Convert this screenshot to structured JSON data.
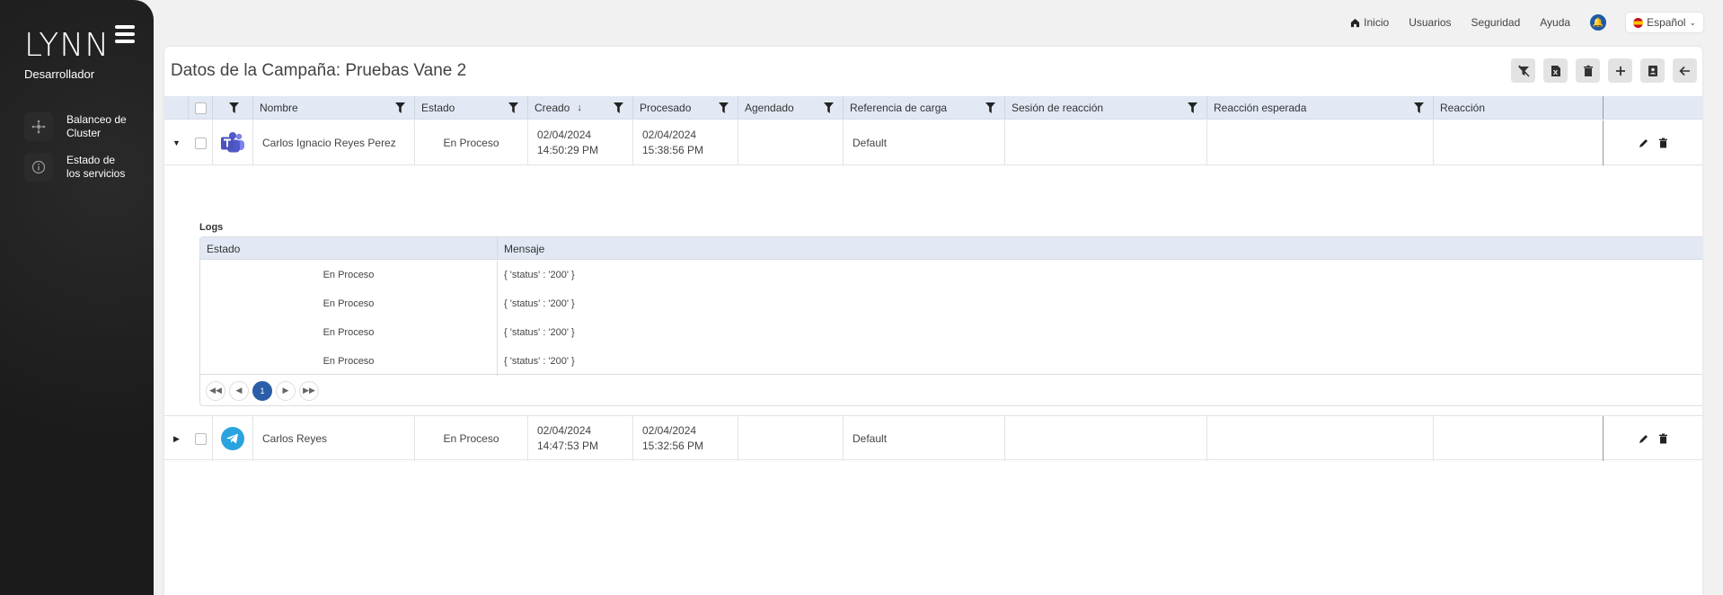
{
  "sidebar": {
    "logo": "LYNN",
    "role": "Desarrollador",
    "items": [
      {
        "label": "Balanceo de Cluster",
        "icon": "cluster-icon"
      },
      {
        "label": "Estado de los servicios",
        "icon": "info-icon"
      }
    ]
  },
  "topnav": {
    "home": "Inicio",
    "users": "Usuarios",
    "security": "Seguridad",
    "help": "Ayuda",
    "language": "Español"
  },
  "panel": {
    "title": "Datos de la Campaña: Pruebas Vane 2"
  },
  "table": {
    "headers": {
      "nombre": "Nombre",
      "estado": "Estado",
      "creado": "Creado",
      "procesado": "Procesado",
      "agendado": "Agendado",
      "referencia": "Referencia de carga",
      "sesion": "Sesión de reacción",
      "reaccion_esperada": "Reacción esperada",
      "reaccion": "Reacción"
    },
    "rows": [
      {
        "channel": "teams",
        "nombre": "Carlos Ignacio Reyes Perez",
        "estado": "En Proceso",
        "creado_date": "02/04/2024",
        "creado_time": "14:50:29 PM",
        "procesado_date": "02/04/2024",
        "procesado_time": "15:38:56 PM",
        "agendado": "",
        "referencia": "Default",
        "sesion": "",
        "reaccion_esperada": "",
        "reaccion": ""
      },
      {
        "channel": "telegram",
        "nombre": "Carlos Reyes",
        "estado": "En Proceso",
        "creado_date": "02/04/2024",
        "creado_time": "14:47:53 PM",
        "procesado_date": "02/04/2024",
        "procesado_time": "15:32:56 PM",
        "agendado": "",
        "referencia": "Default",
        "sesion": "",
        "reaccion_esperada": "",
        "reaccion": ""
      }
    ]
  },
  "logs": {
    "title": "Logs",
    "headers": {
      "estado": "Estado",
      "mensaje": "Mensaje"
    },
    "rows": [
      {
        "estado": "En Proceso",
        "mensaje": "{ 'status' : '200' }"
      },
      {
        "estado": "En Proceso",
        "mensaje": "{ 'status' : '200' }"
      },
      {
        "estado": "En Proceso",
        "mensaje": "{ 'status' : '200' }"
      },
      {
        "estado": "En Proceso",
        "mensaje": "{ 'status' : '200' }"
      }
    ],
    "current_page": "1"
  },
  "colors": {
    "accent": "#2a5ea9",
    "header_bg": "#e2e9f5",
    "sidebar_bg": "#1e1e1e"
  }
}
